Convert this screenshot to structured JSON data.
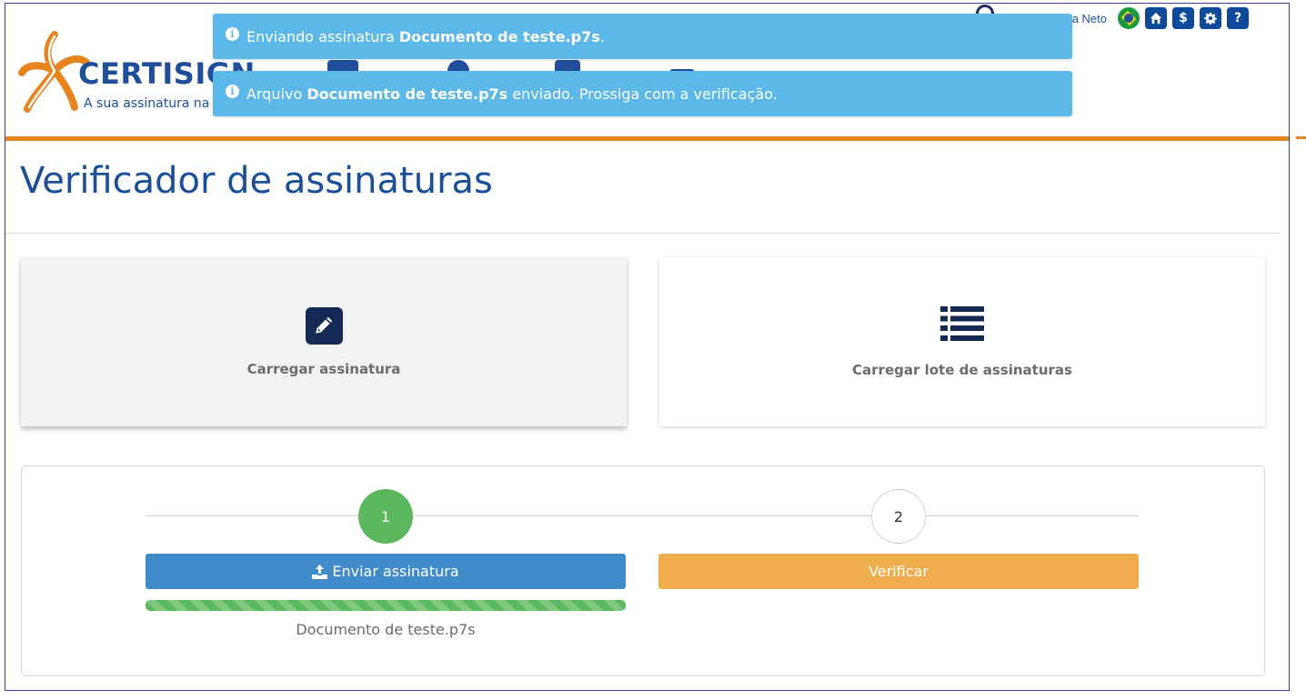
{
  "header": {
    "logo_text": "CERTISIGN",
    "logo_tagline": "A sua assinatura na rede",
    "user_name": "a Neto",
    "icons": [
      "user-icon",
      "brazil-flag-icon",
      "home-icon",
      "dollar-icon",
      "gear-icon",
      "help-icon"
    ],
    "dollar_label": "$",
    "help_label": "?"
  },
  "toasts": [
    {
      "prefix": "Enviando assinatura ",
      "bold": "Documento de teste.p7s",
      "suffix": "."
    },
    {
      "prefix": "Arquivo ",
      "bold": "Documento de teste.p7s",
      "suffix": " enviado. Prossiga com a verificação."
    }
  ],
  "page": {
    "title": "Verificador de assinaturas"
  },
  "cards": [
    {
      "label": "Carregar assinatura",
      "icon": "pencil-icon",
      "active": true
    },
    {
      "label": "Carregar lote de assinaturas",
      "icon": "list-icon",
      "active": false
    }
  ],
  "wizard": {
    "steps": [
      {
        "number": "1",
        "state": "complete"
      },
      {
        "number": "2",
        "state": "pending"
      }
    ],
    "upload_button": "Enviar assinatura",
    "verify_button": "Verificar",
    "progress": 1.0,
    "file_name": "Documento de teste.p7s"
  },
  "colors": {
    "brand_blue": "#1f4f9c",
    "accent_orange": "#e8841d",
    "toast_blue": "#5bb8e8",
    "success_green": "#5cb85c",
    "primary_blue": "#428bca",
    "warning_orange": "#f0ad4e"
  }
}
